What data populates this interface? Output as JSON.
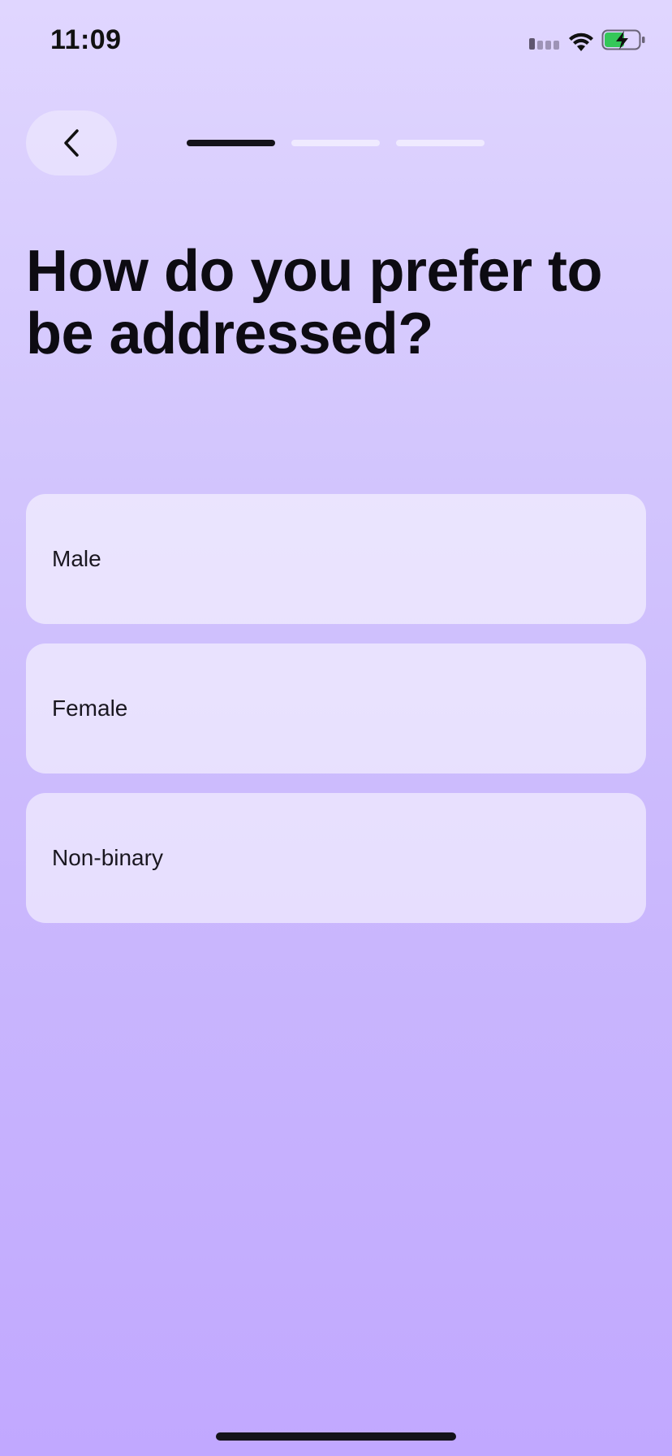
{
  "status_bar": {
    "time": "11:09",
    "signal_bars_active": 1,
    "battery_charging": true,
    "battery_color": "#34c759"
  },
  "header": {
    "back_icon": "chevron-left-icon",
    "progress_steps_total": 3,
    "progress_step_current": 1
  },
  "question": {
    "title": "How do you prefer to be addressed?"
  },
  "options": [
    {
      "label": "Male"
    },
    {
      "label": "Female"
    },
    {
      "label": "Non-binary"
    }
  ],
  "colors": {
    "background_top": "#e0d6ff",
    "background_bottom": "#c1a8ff",
    "text_primary": "#0d0b12",
    "progress_active": "#141219"
  }
}
